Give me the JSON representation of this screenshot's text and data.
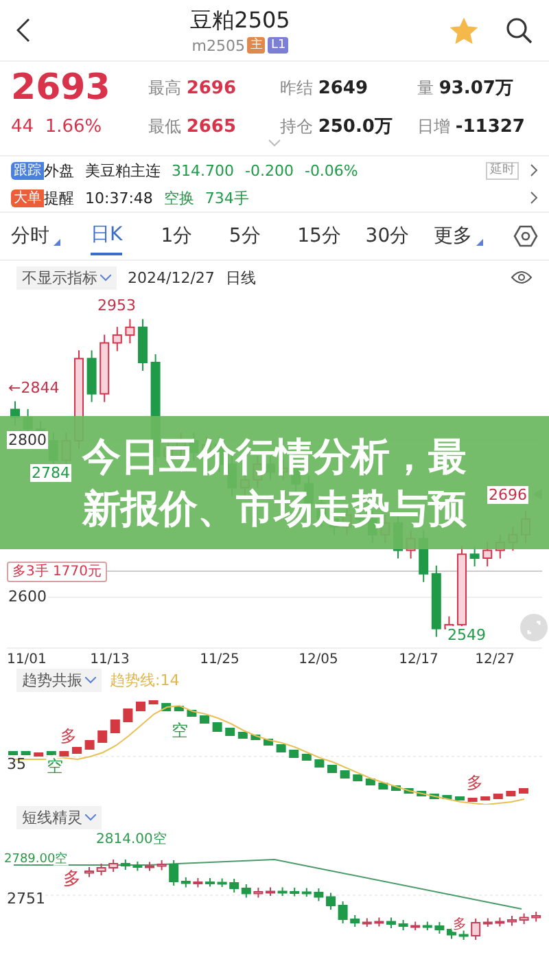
{
  "header": {
    "title": "豆粕2505",
    "code": "m2505",
    "favorited": true,
    "badges": [
      {
        "text": "主",
        "color": "#e0894c"
      },
      {
        "text": "L1",
        "color": "#7c7fd6"
      }
    ]
  },
  "quote": {
    "price": "2693",
    "change": "44",
    "change_pct": "1.66%",
    "stats": [
      {
        "label": "最高",
        "value": "2696",
        "color": "#d8334a"
      },
      {
        "label": "昨结",
        "value": "2649",
        "color": "#222222"
      },
      {
        "label": "量",
        "value": "93.07万",
        "color": "#222222"
      },
      {
        "label": "最低",
        "value": "2665",
        "color": "#d8334a"
      },
      {
        "label": "持仓",
        "value": "250.0万",
        "color": "#222222"
      },
      {
        "label": "日增",
        "value": "-11327",
        "color": "#222222"
      }
    ]
  },
  "alerts": [
    {
      "badge": "跟踪",
      "color": "#4b7fdc",
      "label": "外盘",
      "tag": "延时",
      "items": [
        {
          "text": "美豆粕主连",
          "color": "#222222"
        },
        {
          "text": "314.700",
          "color": "#1f9a48"
        },
        {
          "text": "-0.200",
          "color": "#1f9a48"
        },
        {
          "text": "-0.06%",
          "color": "#1f9a48"
        }
      ]
    },
    {
      "badge": "大单",
      "color": "#ea5f3a",
      "label": "提醒",
      "items": [
        {
          "text": "10:37:48",
          "color": "#222222"
        },
        {
          "text": "空换",
          "color": "#1f9a48"
        },
        {
          "text": "734手",
          "color": "#1f9a48"
        }
      ]
    }
  ],
  "tabs": [
    {
      "label": "分时",
      "selected": false,
      "menu": true
    },
    {
      "label": "日K",
      "selected": true,
      "menu": false
    },
    {
      "label": "1分",
      "selected": false,
      "menu": false
    },
    {
      "label": "5分",
      "selected": false,
      "menu": false
    },
    {
      "label": "15分",
      "selected": false,
      "menu": false
    },
    {
      "label": "30分",
      "selected": false,
      "menu": false
    },
    {
      "label": "更多",
      "selected": false,
      "menu": true
    }
  ],
  "chart_toolbar": {
    "indicator": "不显示指标",
    "date": "2024/12/27",
    "period": "日线"
  },
  "main_chart": {
    "labels": [
      {
        "text": "2953",
        "kind": "high"
      },
      {
        "text": "←2844",
        "kind": "high"
      },
      {
        "text": "2800",
        "kind": "axis"
      },
      {
        "text": "2784",
        "kind": "low"
      },
      {
        "text": "2696",
        "kind": "high"
      },
      {
        "text": "2600",
        "kind": "axis"
      },
      {
        "text": "2549",
        "kind": "low"
      }
    ],
    "position_tag": "多3手 1770元",
    "x_labels": [
      "11/01",
      "11/13",
      "11/25",
      "12/05",
      "12/17",
      "12/27"
    ]
  },
  "trend_panel": {
    "indicator": "趋势共振",
    "line_label": "趋势线:14",
    "axis_label": "35",
    "signals": [
      {
        "text": "空",
        "color": "#2a9a4a"
      },
      {
        "text": "多",
        "color": "#d04050"
      },
      {
        "text": "空",
        "color": "#2a9a4a"
      },
      {
        "text": "多",
        "color": "#d04050"
      }
    ]
  },
  "spirit_panel": {
    "indicator": "短线精灵",
    "axis_label": "2751",
    "signals": [
      {
        "text": "2789.00空",
        "color": "#2a9a4a"
      },
      {
        "text": "多",
        "color": "#d04050"
      },
      {
        "text": "2814.00空",
        "color": "#2a9a4a"
      },
      {
        "text": "多",
        "color": "#d04050"
      }
    ]
  },
  "overlay_banner": {
    "lines": [
      "今日豆价行情分析，最",
      "新报价、市场走势与预"
    ]
  }
}
